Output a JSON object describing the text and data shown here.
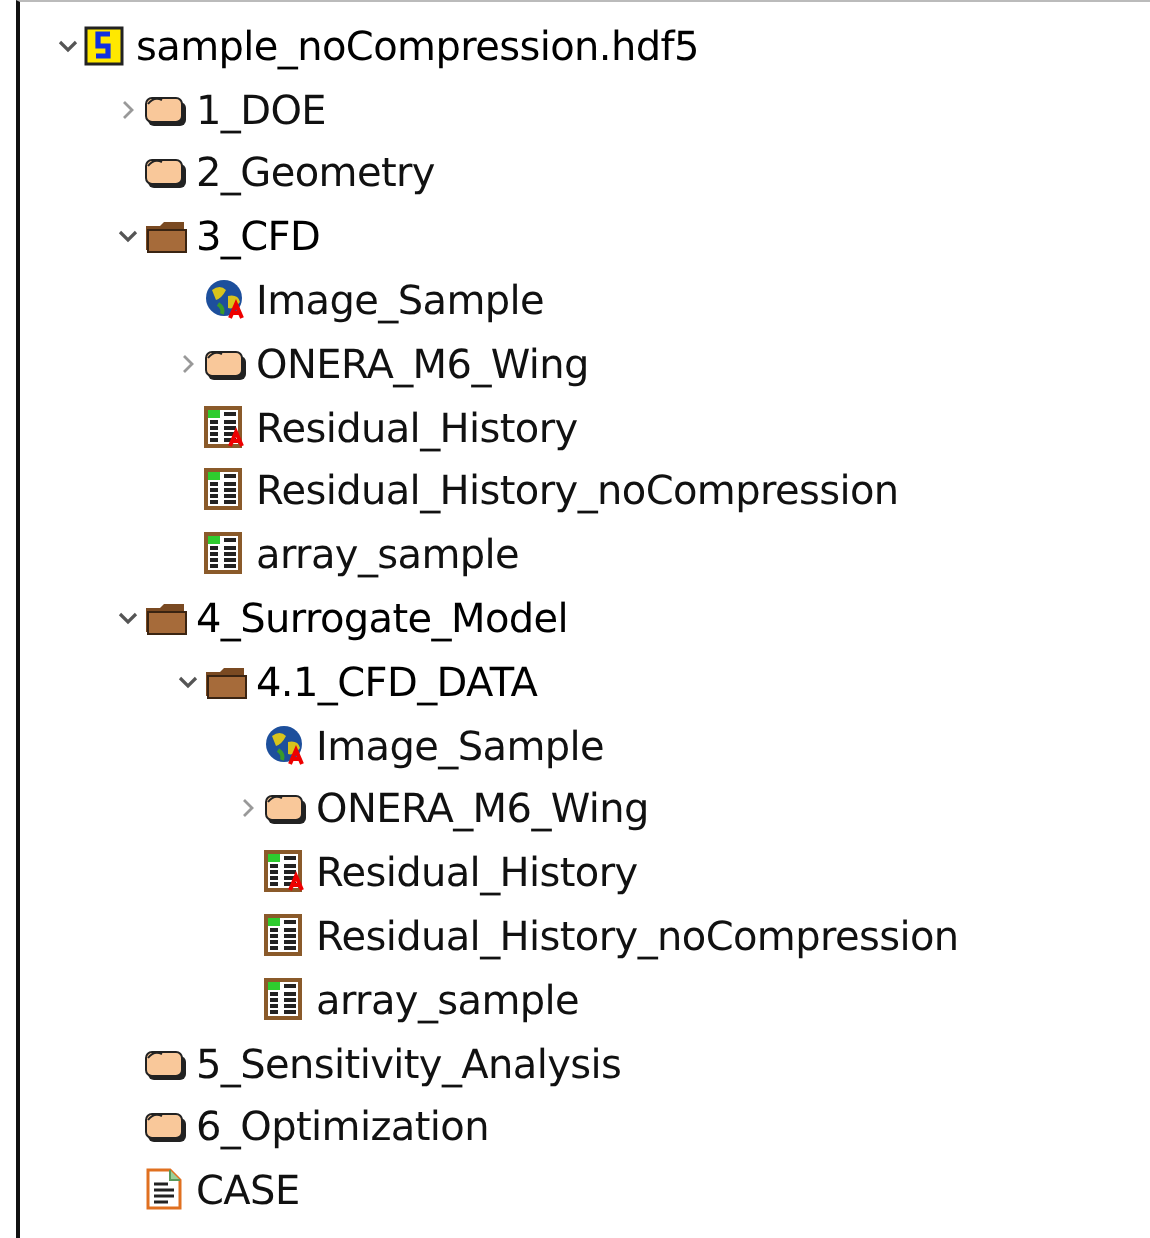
{
  "tree": [
    {
      "label": "sample_noCompression.hdf5",
      "kind": "file",
      "expandable": true,
      "expanded": true,
      "has_attributes": false,
      "children": [
        {
          "label": "1_DOE",
          "kind": "group",
          "expandable": true,
          "expanded": false,
          "has_attributes": false
        },
        {
          "label": "2_Geometry",
          "kind": "group",
          "expandable": false,
          "expanded": false,
          "has_attributes": false
        },
        {
          "label": "3_CFD",
          "kind": "group",
          "expandable": true,
          "expanded": true,
          "has_attributes": false,
          "children": [
            {
              "label": "Image_Sample",
              "kind": "image",
              "expandable": false,
              "expanded": false,
              "has_attributes": true
            },
            {
              "label": "ONERA_M6_Wing",
              "kind": "group",
              "expandable": true,
              "expanded": false,
              "has_attributes": false
            },
            {
              "label": "Residual_History",
              "kind": "table",
              "expandable": false,
              "expanded": false,
              "has_attributes": true
            },
            {
              "label": "Residual_History_noCompression",
              "kind": "table",
              "expandable": false,
              "expanded": false,
              "has_attributes": false
            },
            {
              "label": "array_sample",
              "kind": "table",
              "expandable": false,
              "expanded": false,
              "has_attributes": false
            }
          ]
        },
        {
          "label": "4_Surrogate_Model",
          "kind": "group",
          "expandable": true,
          "expanded": true,
          "has_attributes": false,
          "children": [
            {
              "label": "4.1_CFD_DATA",
              "kind": "group",
              "expandable": true,
              "expanded": true,
              "has_attributes": false,
              "children": [
                {
                  "label": "Image_Sample",
                  "kind": "image",
                  "expandable": false,
                  "expanded": false,
                  "has_attributes": true
                },
                {
                  "label": "ONERA_M6_Wing",
                  "kind": "group",
                  "expandable": true,
                  "expanded": false,
                  "has_attributes": false
                },
                {
                  "label": "Residual_History",
                  "kind": "table",
                  "expandable": false,
                  "expanded": false,
                  "has_attributes": true
                },
                {
                  "label": "Residual_History_noCompression",
                  "kind": "table",
                  "expandable": false,
                  "expanded": false,
                  "has_attributes": false
                },
                {
                  "label": "array_sample",
                  "kind": "table",
                  "expandable": false,
                  "expanded": false,
                  "has_attributes": false
                }
              ]
            }
          ]
        },
        {
          "label": "5_Sensitivity_Analysis",
          "kind": "group",
          "expandable": false,
          "expanded": false,
          "has_attributes": false
        },
        {
          "label": "6_Optimization",
          "kind": "group",
          "expandable": false,
          "expanded": false,
          "has_attributes": false
        },
        {
          "label": "CASE",
          "kind": "text",
          "expandable": false,
          "expanded": false,
          "has_attributes": false
        }
      ]
    }
  ]
}
